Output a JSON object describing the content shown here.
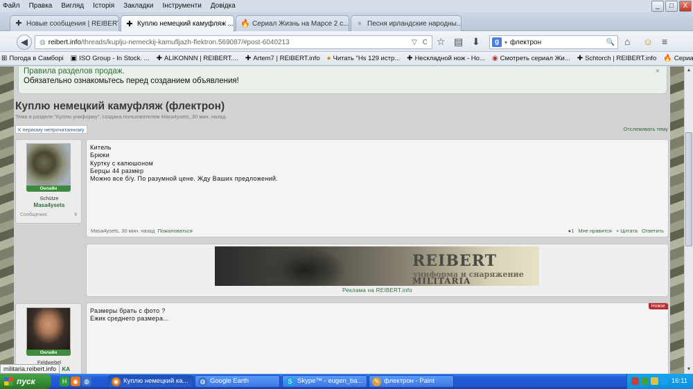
{
  "menubar": {
    "items": [
      "Файл",
      "Правка",
      "Вигляд",
      "Історія",
      "Закладки",
      "Інструменти",
      "Довідка"
    ]
  },
  "window_buttons": {
    "minimize": "_",
    "maximize": "□",
    "close": "X"
  },
  "tabs": [
    {
      "label": "Новые сообщения | REIBERT....",
      "icon": "✚"
    },
    {
      "label": "Куплю немецкий камуфляж ...",
      "icon": "✚"
    },
    {
      "label": "Сериал Жизнь на Марсе 2 с...",
      "icon": "🔥"
    },
    {
      "label": "Песня ирландские народны...",
      "icon": "●"
    }
  ],
  "tab_close": "×",
  "new_tab": "+",
  "navbar": {
    "back": "◀",
    "url_host": "reibert.info",
    "url_path": "/threads/kuplju-nemeckij-kamufljazh-flektron.569087/#post-6040213",
    "url_icons": [
      "▽",
      "C"
    ],
    "search_engine": "g",
    "search_value": "флектрон",
    "search_button": "🔍",
    "toolbar_icons": [
      "☆",
      "▤",
      "⬇",
      "⌂",
      "☺",
      "≡"
    ]
  },
  "bookmarks": [
    {
      "icon": "⊞",
      "label": "Погода в Самборі"
    },
    {
      "icon": "▣",
      "label": "ISO Group - In Stock. ..."
    },
    {
      "icon": "✚",
      "label": "ALIKONNN | REIBERT...."
    },
    {
      "icon": "✚",
      "label": "Artem7 | REIBERT.info"
    },
    {
      "icon": "●",
      "label": "Читать \"Hs 129 истр..."
    },
    {
      "icon": "✚",
      "label": "Нескладной нож - Но..."
    },
    {
      "icon": "◉",
      "label": "Смотреть сериал Жи..."
    },
    {
      "icon": "✚",
      "label": "Schtorch | REIBERT.info"
    },
    {
      "icon": "🔥",
      "label": "Сериал Жизнь на Ма..."
    }
  ],
  "notice": {
    "title": "Правила разделов продаж.",
    "text": "Обязательно ознакомьтесь перед созданием объявления!",
    "close": "×"
  },
  "thread": {
    "title": "Куплю немецкий камуфляж (флектрон)",
    "subtitle": "Тема в разделе \"Куплю униформу\", создана пользователем Masa4ysets, 30 мин. назад.",
    "first_unread": "К первому непрочитанному",
    "watch": "Отслеживать тему"
  },
  "post1": {
    "online": "Онлайн",
    "rank": "Schütze",
    "username": "Masa4ysets",
    "messages_label": "Сообщения:",
    "messages_value": "9",
    "lines": [
      "Китель",
      "Брюки",
      "Куртку с капюшоном",
      "Берцы 44 размер",
      "Можно все б/у. По разумной цене. Жду Ваших предложений."
    ],
    "meta_author": "Masa4ysets, 30 мин. назад",
    "report": "Пожаловаться",
    "likes_count": "●1",
    "like": "Мне нравится",
    "quote": "+ Цитата",
    "reply": "Ответить"
  },
  "ad": {
    "brand": "REIBERT",
    "brand_small": "MILITARIA",
    "tagline": "униформа и снаряжение",
    "label": "Реклама на REIBERT.info"
  },
  "post2": {
    "online": "Онлайн",
    "rank": "Feldwebel",
    "username_partial": "KA",
    "new_badge": "Новое",
    "lines": [
      "Размеры брать с фото ?",
      "Ежик среднего размера..."
    ]
  },
  "status_link": "militaria.reibert.info",
  "taskbar": {
    "start": "пуск",
    "quicklaunch": [
      {
        "label": "H",
        "color": "#2f9a3a"
      },
      {
        "label": "◉",
        "color": "#e07a1a"
      },
      {
        "label": "◍",
        "color": "#3a72c8"
      }
    ],
    "tasks": [
      {
        "label": "Куплю немецкий ка...",
        "icon": "◉",
        "active": true
      },
      {
        "label": "Google Earth",
        "icon": "◍",
        "active": false
      },
      {
        "label": "Skype™ - eugen_ba...",
        "icon": "S",
        "active": false
      },
      {
        "label": "флектрон - Paint",
        "icon": "✎",
        "active": false
      }
    ],
    "clock": "16:11"
  },
  "colors": {
    "accent_green": "#2f6d3b",
    "online_green": "#3e8a3e",
    "taskbar_blue": "#245edb",
    "start_green": "#328a32",
    "new_red": "#b52a2a"
  }
}
